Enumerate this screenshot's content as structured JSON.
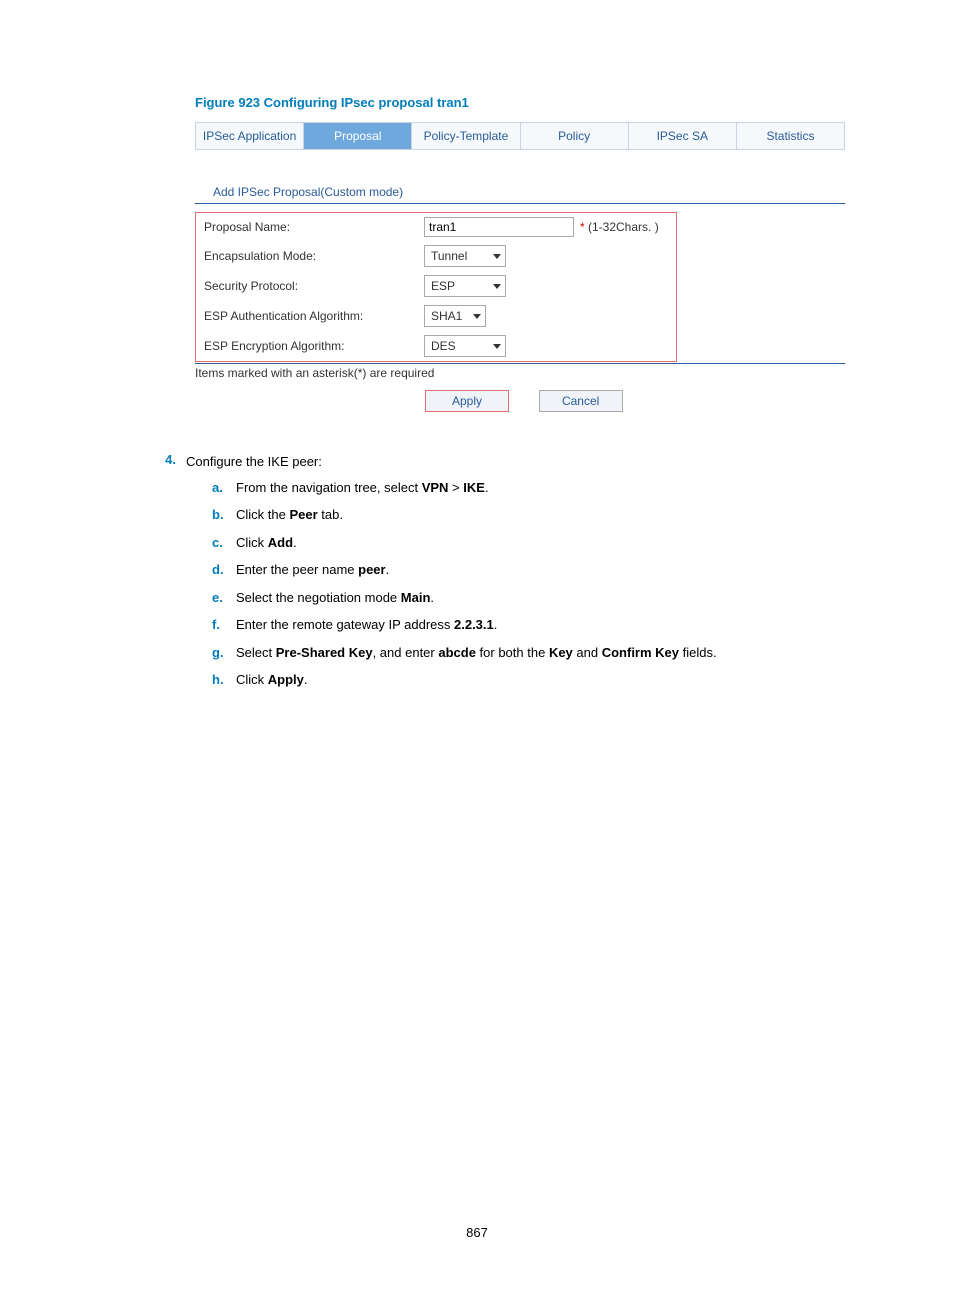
{
  "figure_title": "Figure 923 Configuring IPsec proposal tran1",
  "tabs": [
    "IPSec Application",
    "Proposal",
    "Policy-Template",
    "Policy",
    "IPSec SA",
    "Statistics"
  ],
  "active_tab_index": 1,
  "section_title": "Add IPSec Proposal(Custom mode)",
  "form": {
    "proposal_name_label": "Proposal Name:",
    "proposal_name_value": "tran1",
    "proposal_hint_star": "*",
    "proposal_hint_text": " (1-32Chars. )",
    "encapsulation_label": "Encapsulation Mode:",
    "encapsulation_value": "Tunnel",
    "security_label": "Security Protocol:",
    "security_value": "ESP",
    "esp_auth_label": "ESP Authentication Algorithm:",
    "esp_auth_value": "SHA1",
    "esp_enc_label": "ESP Encryption Algorithm:",
    "esp_enc_value": "DES"
  },
  "required_note": "Items marked with an asterisk(*) are required",
  "buttons": {
    "apply": "Apply",
    "cancel": "Cancel"
  },
  "step": {
    "num": "4.",
    "text": "Configure the IKE peer:"
  },
  "subs": {
    "a": {
      "l": "a.",
      "prefix": "From the navigation tree, select ",
      "b1": "VPN",
      "mid": " > ",
      "b2": "IKE",
      "suffix": "."
    },
    "b": {
      "l": "b.",
      "prefix": "Click the ",
      "b1": "Peer",
      "suffix": " tab."
    },
    "c": {
      "l": "c.",
      "prefix": "Click ",
      "b1": "Add",
      "suffix": "."
    },
    "d": {
      "l": "d.",
      "prefix": "Enter the peer name ",
      "b1": "peer",
      "suffix": "."
    },
    "e": {
      "l": "e.",
      "prefix": "Select the negotiation mode ",
      "b1": "Main",
      "suffix": "."
    },
    "f": {
      "l": "f.",
      "prefix": "Enter the remote gateway IP address ",
      "b1": "2.2.3.1",
      "suffix": "."
    },
    "g": {
      "l": "g.",
      "prefix": "Select ",
      "b1": "Pre-Shared Key",
      "mid1": ", and enter ",
      "b2": "abcde",
      "mid2": " for both the ",
      "b3": "Key",
      "mid3": " and ",
      "b4": "Confirm Key",
      "suffix": " fields."
    },
    "h": {
      "l": "h.",
      "prefix": "Click ",
      "b1": "Apply",
      "suffix": "."
    }
  },
  "page_number": "867"
}
